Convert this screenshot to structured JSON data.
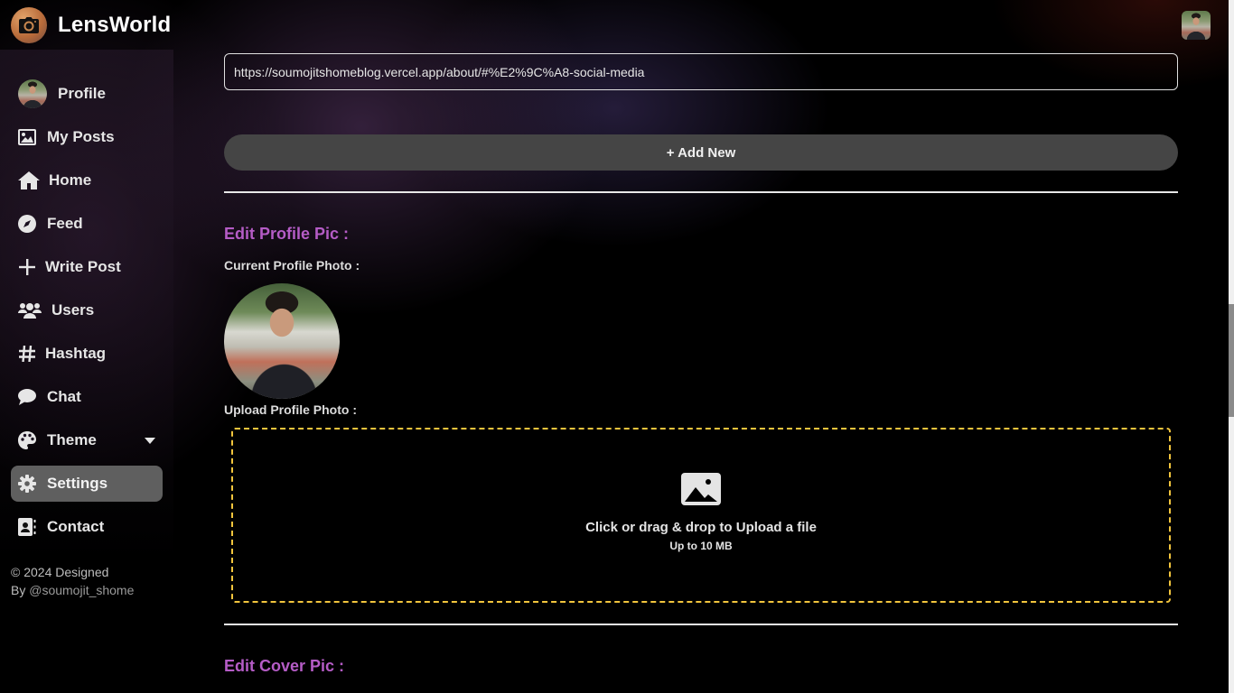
{
  "app": {
    "name": "LensWorld",
    "logo_icon": "camera-icon"
  },
  "sidebar": {
    "items": [
      {
        "label": "Profile",
        "icon": "user-avatar"
      },
      {
        "label": "My Posts",
        "icon": "image-icon"
      },
      {
        "label": "Home",
        "icon": "home-icon"
      },
      {
        "label": "Feed",
        "icon": "compass-icon"
      },
      {
        "label": "Write Post",
        "icon": "plus-icon"
      },
      {
        "label": "Users",
        "icon": "users-icon"
      },
      {
        "label": "Hashtag",
        "icon": "hashtag-icon"
      },
      {
        "label": "Chat",
        "icon": "chat-bubble-icon"
      },
      {
        "label": "Theme",
        "icon": "palette-icon",
        "has_dropdown": true
      },
      {
        "label": "Settings",
        "icon": "gear-icon",
        "active": true
      },
      {
        "label": "Contact",
        "icon": "contact-book-icon"
      }
    ],
    "footer": {
      "line1": "© 2024 Designed",
      "by": "By ",
      "handle": "@soumojit_shome"
    }
  },
  "main": {
    "link_input_value": "https://soumojitshomeblog.vercel.app/about/#%E2%9C%A8-social-media",
    "add_new_label": "+ Add New",
    "profile_pic_section": {
      "title": "Edit Profile Pic :",
      "current_label": "Current Profile Photo :",
      "upload_label": "Upload Profile Photo :",
      "dropzone_text": "Click or drag & drop to Upload a file",
      "dropzone_limit": "Up to 10 MB"
    },
    "cover_pic_section": {
      "title": "Edit Cover Pic :"
    }
  },
  "colors": {
    "section_title": "#b55cc6",
    "dropzone_border": "#f2c53d",
    "active_nav_bg": "#5f5f5f",
    "button_bg": "#454545"
  }
}
